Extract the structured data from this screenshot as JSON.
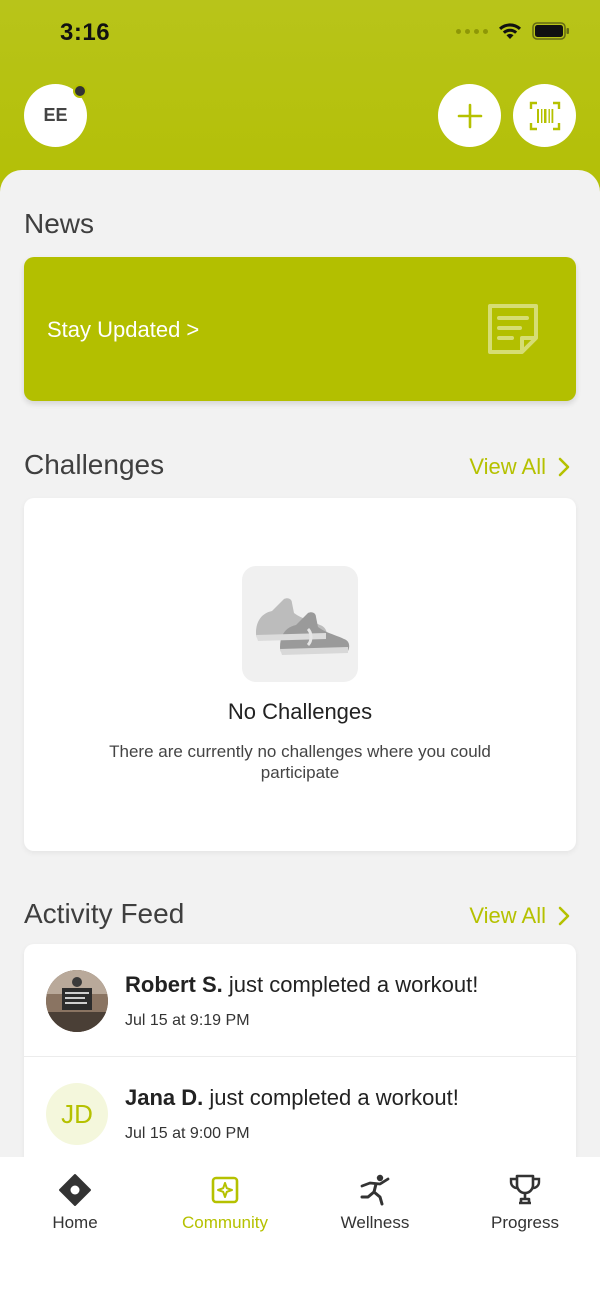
{
  "status_bar": {
    "time": "3:16"
  },
  "header": {
    "avatar_initials": "EE",
    "add_icon": "plus-icon",
    "scan_icon": "barcode-scan-icon"
  },
  "news": {
    "title": "News",
    "card_label": "Stay Updated >",
    "card_icon": "note-icon"
  },
  "challenges": {
    "title": "Challenges",
    "view_all": "View All",
    "empty_title": "No Challenges",
    "empty_text": "There are currently no challenges where you could participate"
  },
  "activity_feed": {
    "title": "Activity Feed",
    "view_all": "View All",
    "items": [
      {
        "name": "Robert S.",
        "action": "just completed a workout!",
        "time": "Jul 15 at 9:19 PM",
        "avatar": "photo"
      },
      {
        "name": "Jana D.",
        "action": "just completed a workout!",
        "time": "Jul 15 at 9:00 PM",
        "initials": "JD"
      }
    ]
  },
  "tabs": [
    {
      "label": "Home",
      "icon": "home-icon",
      "active": false
    },
    {
      "label": "Community",
      "icon": "community-icon",
      "active": true
    },
    {
      "label": "Wellness",
      "icon": "wellness-icon",
      "active": false
    },
    {
      "label": "Progress",
      "icon": "trophy-icon",
      "active": false
    }
  ],
  "colors": {
    "accent": "#b5c100",
    "background": "#f2f2f2",
    "text": "#3f3f3f"
  }
}
